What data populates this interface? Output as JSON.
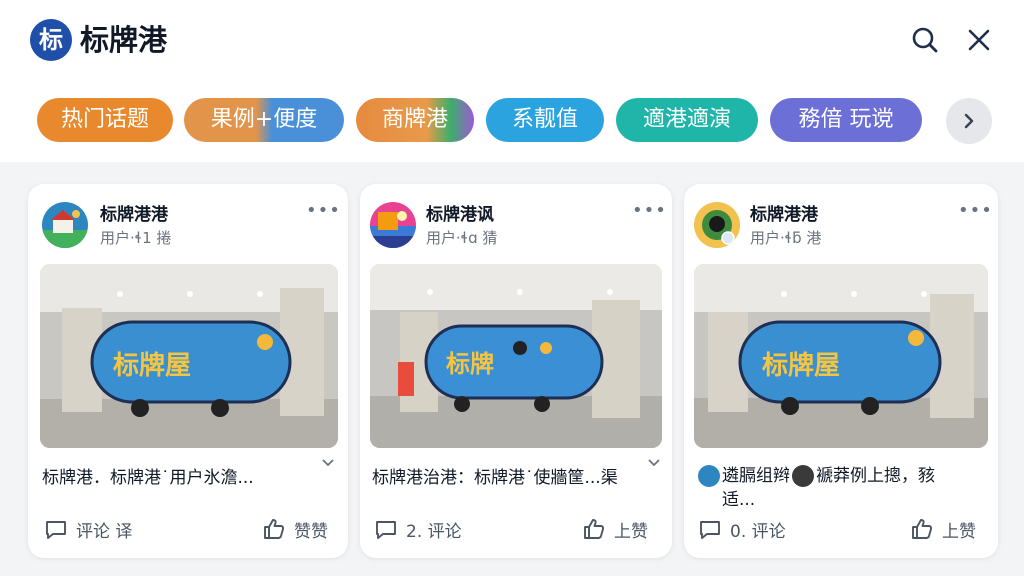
{
  "header": {
    "logo_char": "标",
    "title": "标牌港",
    "search_icon": "search-icon",
    "close_icon": "close-icon"
  },
  "tabs": [
    {
      "label": "热门话题",
      "color": "#e8892e"
    },
    {
      "label": "果例+便度",
      "color": "#e2954a"
    },
    {
      "label": "商牌港",
      "color": "#e2994d"
    },
    {
      "label": "系靓值",
      "color": "#2aa3df"
    },
    {
      "label": "適港適演",
      "color": "#1fb5a8"
    },
    {
      "label": "務偣 玩谠",
      "color": "#6b6fd6"
    }
  ],
  "tabs_more_icon": "chevron-right-icon",
  "posts": [
    {
      "author": "标牌港港",
      "meta": "用户·ɬ1 捲",
      "caption": "标牌港．标牌港˙用户氷澹...",
      "comment_label": "评论 译",
      "like_label": "赞赞",
      "sign_text": "标牌屋",
      "avatar_color": "#2e86c1"
    },
    {
      "author": "标牌港讽",
      "meta": "用户·ɬɑ 猜",
      "caption": "标牌港治港：标牌港˙使牆筐...渠",
      "comment_label": "2. 评论",
      "like_label": "上赞",
      "sign_text": "标牌",
      "avatar_color": "#e84393"
    },
    {
      "author": "标牌港港",
      "meta": "用户·ɬƃ 港",
      "caption_a": "遴膈组辫",
      "caption_b": "褫莽例上摠，豥",
      "caption_c": "适...",
      "comment_label": "0. 评论",
      "like_label": "上赞",
      "sign_text": "标牌屋",
      "avatar_color": "#3d8b3d"
    }
  ]
}
